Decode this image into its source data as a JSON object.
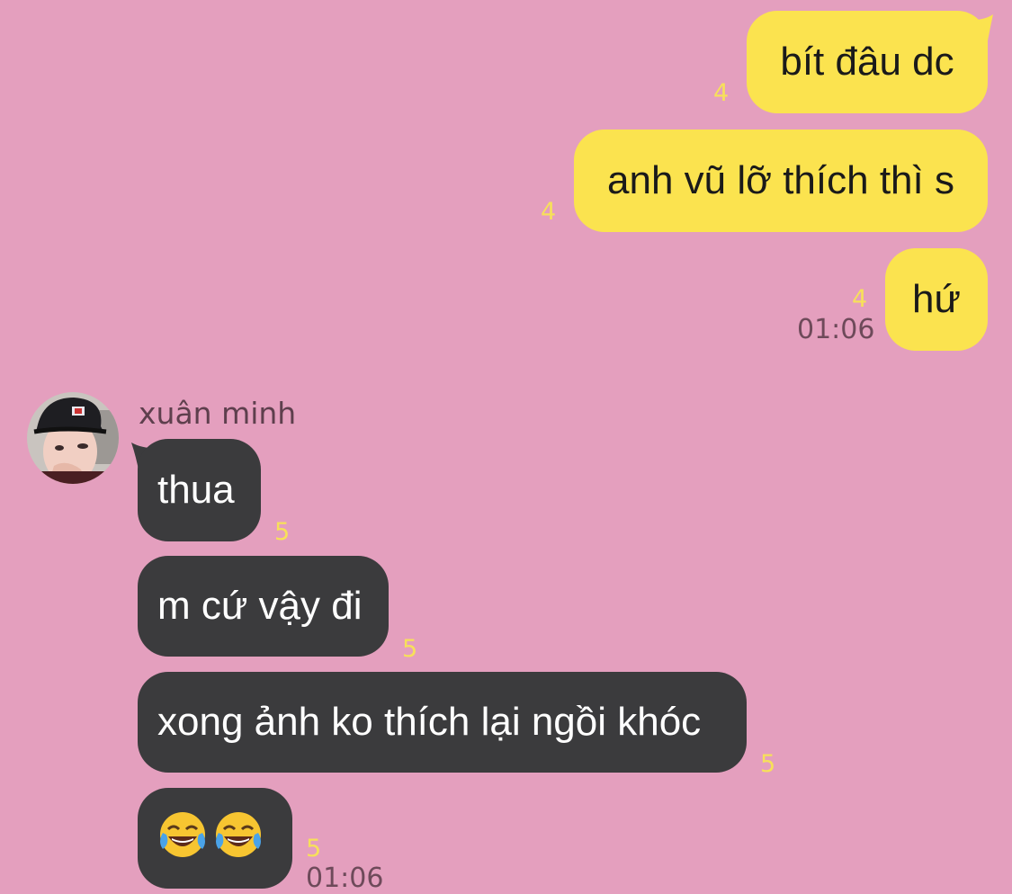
{
  "outgoing": [
    {
      "text": "bít đâu dc",
      "unread": "4"
    },
    {
      "text": "anh vũ lỡ thích thì s",
      "unread": "4"
    },
    {
      "text": "hứ",
      "unread": "4",
      "time": "01:06"
    }
  ],
  "contact": {
    "name": "xuân minh",
    "avatar": "profile photo of young man wearing black cap"
  },
  "incoming": [
    {
      "text": "thua",
      "unread": "5"
    },
    {
      "text": "m cứ vậy đi",
      "unread": "5"
    },
    {
      "text": "xong ảnh ko thích lại ngồi khóc",
      "unread": "5"
    },
    {
      "text": "",
      "emoji": [
        "face-with-tears-of-joy-icon",
        "face-with-tears-of-joy-icon"
      ],
      "unread": "5",
      "time": "01:06"
    }
  ],
  "colors": {
    "background": "#e49fbe",
    "outgoing_bubble": "#fbe34f",
    "incoming_bubble": "#3b3b3d",
    "unread_count": "#f7e05a"
  }
}
